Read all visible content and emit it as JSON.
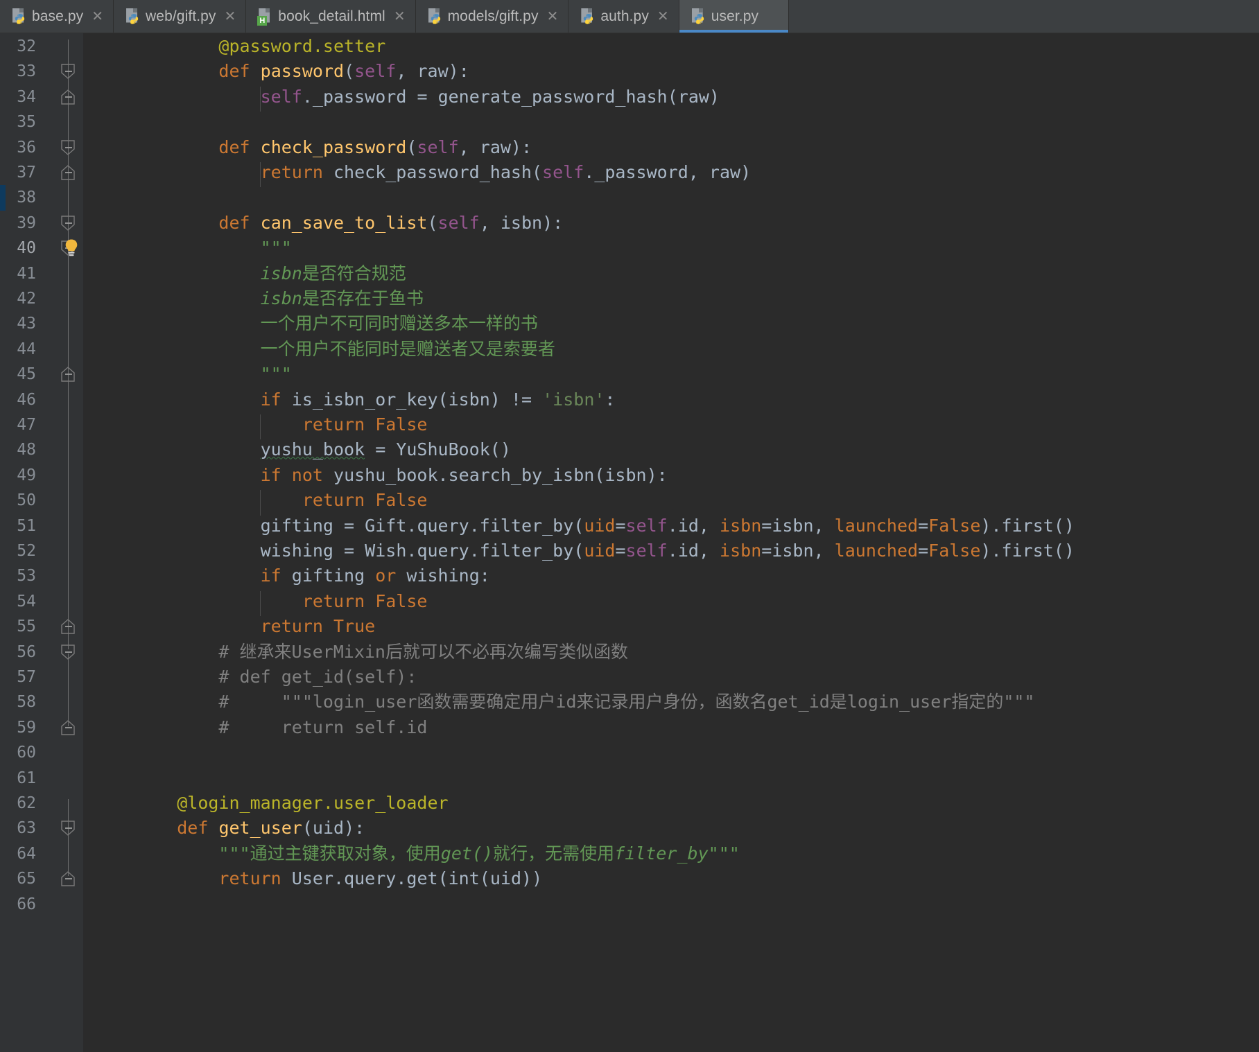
{
  "window": {
    "app": "pycharm-editor",
    "active_file": "user.py"
  },
  "colors": {
    "editor_bg": "#2b2b2b",
    "gutter_bg": "#313335",
    "tabbar_bg": "#3c3f41",
    "active_tab_bg": "#4e5254",
    "active_tab_underline": "#4a88c7",
    "keyword": "#cc7832",
    "function": "#ffc66d",
    "decorator": "#bbb529",
    "self": "#94558d",
    "string": "#6a8759",
    "docstring": "#629755",
    "comment": "#808080",
    "plain_text": "#a9b7c6",
    "line_number": "#888e95",
    "current_line_bg": "#323232",
    "vcs_modified": "#0e3a5e",
    "warning_squiggle": "#3d7a4a",
    "lightbulb": "#f2b83d"
  },
  "tabs": [
    {
      "label": "base.py",
      "icon": "python-file-icon",
      "active": false,
      "closable": true
    },
    {
      "label": "web/gift.py",
      "icon": "python-file-icon",
      "active": false,
      "closable": true
    },
    {
      "label": "book_detail.html",
      "icon": "html-file-icon",
      "active": false,
      "closable": true
    },
    {
      "label": "models/gift.py",
      "icon": "python-file-icon",
      "active": false,
      "closable": true
    },
    {
      "label": "auth.py",
      "icon": "python-file-icon",
      "active": false,
      "closable": true
    },
    {
      "label": "user.py",
      "icon": "python-file-icon",
      "active": true,
      "closable": true
    }
  ],
  "tab_close_glyph": "✕",
  "editor": {
    "first_line": 32,
    "last_line": 66,
    "current_line": 40,
    "vcs_modified_lines": [
      38
    ],
    "lightbulb_line": 40,
    "line_numbers": [
      "32",
      "33",
      "34",
      "35",
      "36",
      "37",
      "38",
      "39",
      "40",
      "41",
      "42",
      "43",
      "44",
      "45",
      "46",
      "47",
      "48",
      "49",
      "50",
      "51",
      "52",
      "53",
      "54",
      "55",
      "56",
      "57",
      "58",
      "59",
      "60",
      "61",
      "62",
      "63",
      "64",
      "65",
      "66"
    ],
    "lines": [
      {
        "n": "32",
        "text": "        @password.setter"
      },
      {
        "n": "33",
        "text": "        def password(self, raw):"
      },
      {
        "n": "34",
        "text": "            self._password = generate_password_hash(raw)"
      },
      {
        "n": "35",
        "text": ""
      },
      {
        "n": "36",
        "text": "        def check_password(self, raw):"
      },
      {
        "n": "37",
        "text": "            return check_password_hash(self._password, raw)"
      },
      {
        "n": "38",
        "text": ""
      },
      {
        "n": "39",
        "text": "        def can_save_to_list(self, isbn):"
      },
      {
        "n": "40",
        "text": "            \"\"\""
      },
      {
        "n": "41",
        "text": "            isbn是否符合规范"
      },
      {
        "n": "42",
        "text": "            isbn是否存在于鱼书"
      },
      {
        "n": "43",
        "text": "            一个用户不可同时赠送多本一样的书"
      },
      {
        "n": "44",
        "text": "            一个用户不能同时是赠送者又是索要者"
      },
      {
        "n": "45",
        "text": "            \"\"\""
      },
      {
        "n": "46",
        "text": "            if is_isbn_or_key(isbn) != 'isbn':"
      },
      {
        "n": "47",
        "text": "                return False"
      },
      {
        "n": "48",
        "text": "            yushu_book = YuShuBook()"
      },
      {
        "n": "49",
        "text": "            if not yushu_book.search_by_isbn(isbn):"
      },
      {
        "n": "50",
        "text": "                return False"
      },
      {
        "n": "51",
        "text": "            gifting = Gift.query.filter_by(uid=self.id, isbn=isbn, launched=False).first()"
      },
      {
        "n": "52",
        "text": "            wishing = Wish.query.filter_by(uid=self.id, isbn=isbn, launched=False).first()"
      },
      {
        "n": "53",
        "text": "            if gifting or wishing:"
      },
      {
        "n": "54",
        "text": "                return False"
      },
      {
        "n": "55",
        "text": "            return True"
      },
      {
        "n": "56",
        "text": "        # 继承来UserMixin后就可以不必再次编写类似函数"
      },
      {
        "n": "57",
        "text": "        # def get_id(self):"
      },
      {
        "n": "58",
        "text": "        #     \"\"\"login_user函数需要确定用户id来记录用户身份，函数名get_id是login_user指定的\"\"\""
      },
      {
        "n": "59",
        "text": "        #     return self.id"
      },
      {
        "n": "60",
        "text": ""
      },
      {
        "n": "61",
        "text": ""
      },
      {
        "n": "62",
        "text": "    @login_manager.user_loader"
      },
      {
        "n": "63",
        "text": "    def get_user(uid):"
      },
      {
        "n": "64",
        "text": "        \"\"\"通过主键获取对象，使用get()就行，无需使用filter_by\"\"\""
      },
      {
        "n": "65",
        "text": "        return User.query.get(int(uid))"
      },
      {
        "n": "66",
        "text": ""
      }
    ],
    "inspection_warnings": [
      {
        "line": "48",
        "symbol": "yushu_book",
        "kind": "weak-warning-squiggle"
      }
    ],
    "fold_markers": [
      {
        "line": "33",
        "type": "fold-collapse-top"
      },
      {
        "line": "34",
        "type": "fold-collapse-bottom"
      },
      {
        "line": "36",
        "type": "fold-collapse-top"
      },
      {
        "line": "37",
        "type": "fold-collapse-bottom"
      },
      {
        "line": "39",
        "type": "fold-collapse-top"
      },
      {
        "line": "40",
        "type": "fold-collapse-top"
      },
      {
        "line": "45",
        "type": "fold-collapse-bottom"
      },
      {
        "line": "55",
        "type": "fold-collapse-bottom"
      },
      {
        "line": "56",
        "type": "fold-collapse-top"
      },
      {
        "line": "59",
        "type": "fold-collapse-bottom"
      },
      {
        "line": "63",
        "type": "fold-collapse-top"
      },
      {
        "line": "65",
        "type": "fold-collapse-bottom"
      }
    ]
  }
}
